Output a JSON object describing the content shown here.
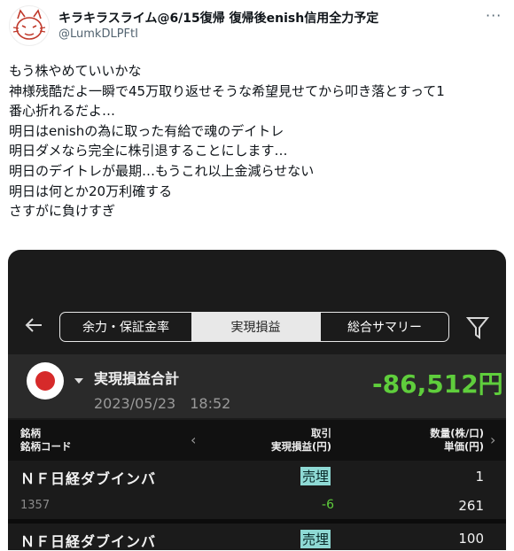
{
  "tweet": {
    "display_name": "キラキラスライム@6/15復帰 復帰後enish信用全力予定",
    "handle": "@LumkDLPFtI",
    "more_glyph": "···",
    "lines": [
      "もう株やめていいかな",
      "神様残酷だよ一瞬で45万取り返せそうな希望見せてから叩き落とすって1",
      "番心折れるだよ…",
      "明日はenishの為に取った有給で魂のデイトレ",
      "明日ダメなら完全に株引退することにします…",
      "明日のデイトレが最期…もうこれ以上金減らせない",
      "明日は何とか20万利確する",
      "さすがに負けすぎ"
    ]
  },
  "app": {
    "tabs": [
      "余力・保証金率",
      "実現損益",
      "総合サマリー"
    ],
    "selected_tab": "実現損益",
    "summary_label": "実現損益合計",
    "summary_datetime": "2023/05/23　18:52",
    "summary_value": "-86,512円",
    "header": {
      "left_line1": "銘柄",
      "left_line2": "銘柄コード",
      "mid_line1": "取引",
      "mid_line2": "実現損益(円)",
      "right_line1": "数量(株/口)",
      "right_line2": "単価(円)"
    },
    "rows": [
      {
        "name": "ＮＦ日経ダブインバ",
        "code": "1357",
        "trade": "売埋",
        "pl": "-6",
        "qty": "1",
        "price": "261"
      },
      {
        "name": "ＮＦ日経ダブインバ",
        "trade": "売埋",
        "qty": "100"
      }
    ]
  },
  "colors": {
    "positive_green": "#5fce3c",
    "badge_teal": "#8ed9d4",
    "app_bg": "#1b1b1b"
  }
}
